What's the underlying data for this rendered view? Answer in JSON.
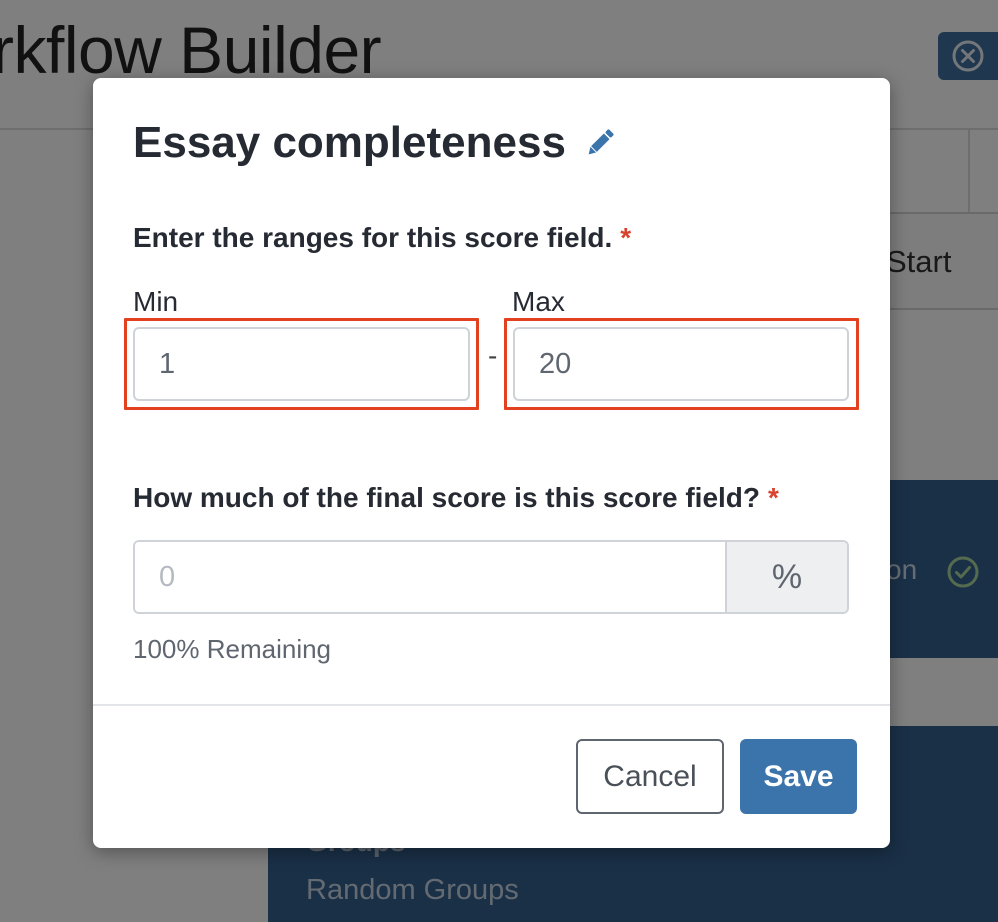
{
  "background": {
    "page_title": "rkflow Builder",
    "start_label": "Start",
    "step_label_partial": "on",
    "groups_label_partial": "Groups",
    "random_groups_label": "Random Groups"
  },
  "modal": {
    "title": "Essay completeness",
    "edit_icon": "pencil-icon",
    "range_question": "Enter the ranges for this score field.",
    "required_marker": "*",
    "min_label": "Min",
    "min_value": "1",
    "separator": "-",
    "max_label": "Max",
    "max_value": "20",
    "weight_question": "How much of the final score is this score field?",
    "weight_placeholder": "0",
    "weight_suffix": "%",
    "remaining_text": "100% Remaining",
    "cancel_label": "Cancel",
    "save_label": "Save"
  },
  "colors": {
    "primary": "#3b73ab",
    "required": "#d8432e",
    "highlight": "#e3401f",
    "header_blue": "#34618f"
  }
}
